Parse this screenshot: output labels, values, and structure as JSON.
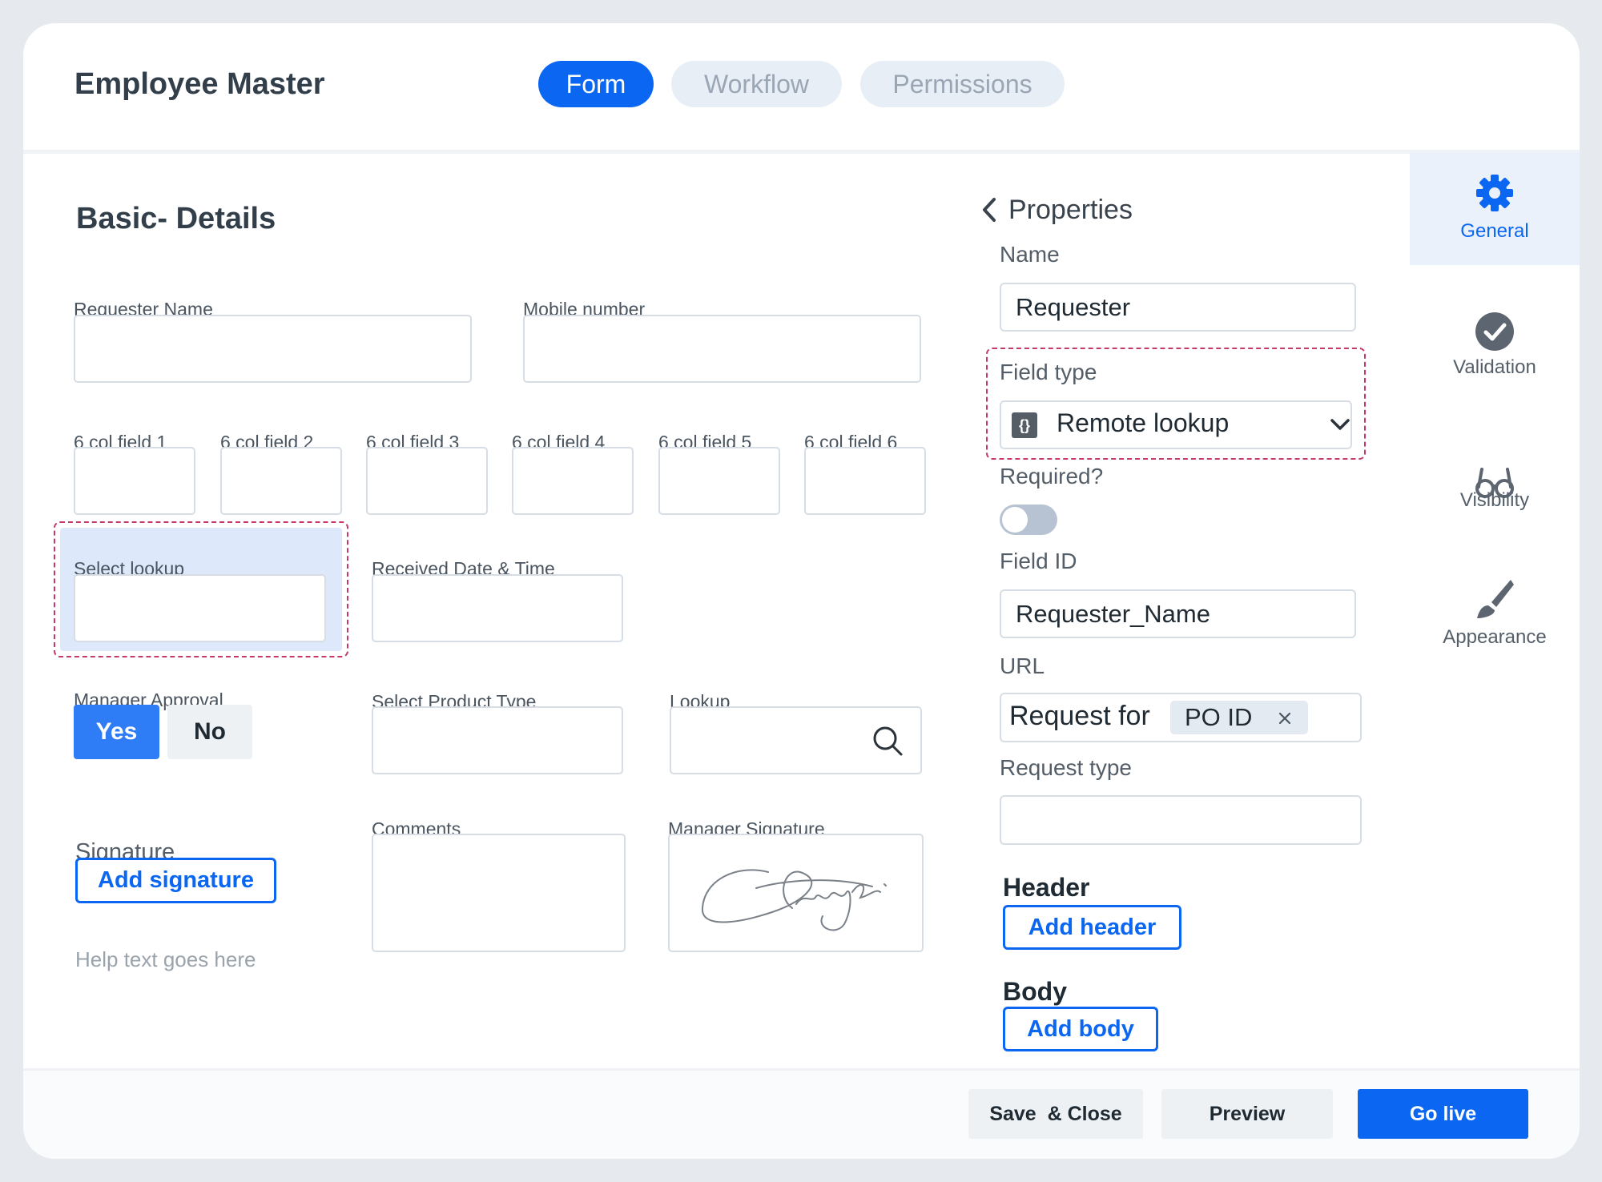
{
  "app": {
    "title": "Employee Master"
  },
  "tabs": [
    {
      "label": "Form",
      "active": true
    },
    {
      "label": "Workflow",
      "active": false
    },
    {
      "label": "Permissions",
      "active": false
    }
  ],
  "form": {
    "section_title": "Basic- Details",
    "requester_name_label": "Requester Name",
    "mobile_number_label": "Mobile number",
    "col_fields": [
      "6 col field 1",
      "6 col field 2",
      "6 col field 3",
      "6 col field 4",
      "6 col field 5",
      "6 col field 6"
    ],
    "select_lookup_label": "Select lookup",
    "received_datetime_label": "Received Date & Time",
    "manager_approval_label": "Manager Approval",
    "approval_options": [
      "Yes",
      "No"
    ],
    "approval_selected": "Yes",
    "select_product_type_label": "Select Product Type",
    "lookup_label": "Lookup",
    "comments_label": "Comments",
    "manager_signature_label": "Manager Signature",
    "signature_label": "Signature",
    "add_signature_label": "Add signature",
    "help_text": "Help text goes here"
  },
  "properties": {
    "title": "Properties",
    "name_label": "Name",
    "name_value": "Requester",
    "field_type_label": "Field type",
    "field_type_icon": "{}",
    "field_type_value": "Remote lookup",
    "required_label": "Required?",
    "required_on": false,
    "field_id_label": "Field ID",
    "field_id_value": "Requester_Name",
    "url_label": "URL",
    "url_text": "Request for",
    "url_chip": "PO ID",
    "request_type_label": "Request type",
    "header_label": "Header",
    "add_header_label": "Add header",
    "body_label": "Body",
    "add_body_label": "Add body"
  },
  "rail": {
    "items": [
      {
        "label": "General",
        "icon": "gear-icon",
        "active": true
      },
      {
        "label": "Validation",
        "icon": "check-circle-icon",
        "active": false
      },
      {
        "label": "Visibility",
        "icon": "glasses-icon",
        "active": false
      },
      {
        "label": "Appearance",
        "icon": "brush-icon",
        "active": false
      }
    ]
  },
  "footer": {
    "save_close_label": "Save  & Close",
    "preview_label": "Preview",
    "go_live_label": "Go live"
  },
  "colors": {
    "accent": "#0b67f2",
    "dashed_outline": "#c4386a",
    "rail_active_bg": "#eaf1fb"
  }
}
